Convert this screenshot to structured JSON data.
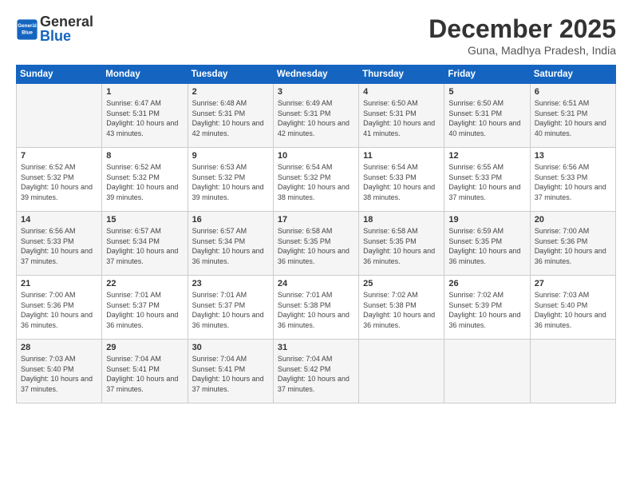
{
  "logo": {
    "line1": "General",
    "line2": "Blue"
  },
  "title": "December 2025",
  "location": "Guna, Madhya Pradesh, India",
  "days_of_week": [
    "Sunday",
    "Monday",
    "Tuesday",
    "Wednesday",
    "Thursday",
    "Friday",
    "Saturday"
  ],
  "weeks": [
    [
      {
        "day": "",
        "sunrise": "",
        "sunset": "",
        "daylight": ""
      },
      {
        "day": "1",
        "sunrise": "Sunrise: 6:47 AM",
        "sunset": "Sunset: 5:31 PM",
        "daylight": "Daylight: 10 hours and 43 minutes."
      },
      {
        "day": "2",
        "sunrise": "Sunrise: 6:48 AM",
        "sunset": "Sunset: 5:31 PM",
        "daylight": "Daylight: 10 hours and 42 minutes."
      },
      {
        "day": "3",
        "sunrise": "Sunrise: 6:49 AM",
        "sunset": "Sunset: 5:31 PM",
        "daylight": "Daylight: 10 hours and 42 minutes."
      },
      {
        "day": "4",
        "sunrise": "Sunrise: 6:50 AM",
        "sunset": "Sunset: 5:31 PM",
        "daylight": "Daylight: 10 hours and 41 minutes."
      },
      {
        "day": "5",
        "sunrise": "Sunrise: 6:50 AM",
        "sunset": "Sunset: 5:31 PM",
        "daylight": "Daylight: 10 hours and 40 minutes."
      },
      {
        "day": "6",
        "sunrise": "Sunrise: 6:51 AM",
        "sunset": "Sunset: 5:31 PM",
        "daylight": "Daylight: 10 hours and 40 minutes."
      }
    ],
    [
      {
        "day": "7",
        "sunrise": "Sunrise: 6:52 AM",
        "sunset": "Sunset: 5:32 PM",
        "daylight": "Daylight: 10 hours and 39 minutes."
      },
      {
        "day": "8",
        "sunrise": "Sunrise: 6:52 AM",
        "sunset": "Sunset: 5:32 PM",
        "daylight": "Daylight: 10 hours and 39 minutes."
      },
      {
        "day": "9",
        "sunrise": "Sunrise: 6:53 AM",
        "sunset": "Sunset: 5:32 PM",
        "daylight": "Daylight: 10 hours and 39 minutes."
      },
      {
        "day": "10",
        "sunrise": "Sunrise: 6:54 AM",
        "sunset": "Sunset: 5:32 PM",
        "daylight": "Daylight: 10 hours and 38 minutes."
      },
      {
        "day": "11",
        "sunrise": "Sunrise: 6:54 AM",
        "sunset": "Sunset: 5:33 PM",
        "daylight": "Daylight: 10 hours and 38 minutes."
      },
      {
        "day": "12",
        "sunrise": "Sunrise: 6:55 AM",
        "sunset": "Sunset: 5:33 PM",
        "daylight": "Daylight: 10 hours and 37 minutes."
      },
      {
        "day": "13",
        "sunrise": "Sunrise: 6:56 AM",
        "sunset": "Sunset: 5:33 PM",
        "daylight": "Daylight: 10 hours and 37 minutes."
      }
    ],
    [
      {
        "day": "14",
        "sunrise": "Sunrise: 6:56 AM",
        "sunset": "Sunset: 5:33 PM",
        "daylight": "Daylight: 10 hours and 37 minutes."
      },
      {
        "day": "15",
        "sunrise": "Sunrise: 6:57 AM",
        "sunset": "Sunset: 5:34 PM",
        "daylight": "Daylight: 10 hours and 37 minutes."
      },
      {
        "day": "16",
        "sunrise": "Sunrise: 6:57 AM",
        "sunset": "Sunset: 5:34 PM",
        "daylight": "Daylight: 10 hours and 36 minutes."
      },
      {
        "day": "17",
        "sunrise": "Sunrise: 6:58 AM",
        "sunset": "Sunset: 5:35 PM",
        "daylight": "Daylight: 10 hours and 36 minutes."
      },
      {
        "day": "18",
        "sunrise": "Sunrise: 6:58 AM",
        "sunset": "Sunset: 5:35 PM",
        "daylight": "Daylight: 10 hours and 36 minutes."
      },
      {
        "day": "19",
        "sunrise": "Sunrise: 6:59 AM",
        "sunset": "Sunset: 5:35 PM",
        "daylight": "Daylight: 10 hours and 36 minutes."
      },
      {
        "day": "20",
        "sunrise": "Sunrise: 7:00 AM",
        "sunset": "Sunset: 5:36 PM",
        "daylight": "Daylight: 10 hours and 36 minutes."
      }
    ],
    [
      {
        "day": "21",
        "sunrise": "Sunrise: 7:00 AM",
        "sunset": "Sunset: 5:36 PM",
        "daylight": "Daylight: 10 hours and 36 minutes."
      },
      {
        "day": "22",
        "sunrise": "Sunrise: 7:01 AM",
        "sunset": "Sunset: 5:37 PM",
        "daylight": "Daylight: 10 hours and 36 minutes."
      },
      {
        "day": "23",
        "sunrise": "Sunrise: 7:01 AM",
        "sunset": "Sunset: 5:37 PM",
        "daylight": "Daylight: 10 hours and 36 minutes."
      },
      {
        "day": "24",
        "sunrise": "Sunrise: 7:01 AM",
        "sunset": "Sunset: 5:38 PM",
        "daylight": "Daylight: 10 hours and 36 minutes."
      },
      {
        "day": "25",
        "sunrise": "Sunrise: 7:02 AM",
        "sunset": "Sunset: 5:38 PM",
        "daylight": "Daylight: 10 hours and 36 minutes."
      },
      {
        "day": "26",
        "sunrise": "Sunrise: 7:02 AM",
        "sunset": "Sunset: 5:39 PM",
        "daylight": "Daylight: 10 hours and 36 minutes."
      },
      {
        "day": "27",
        "sunrise": "Sunrise: 7:03 AM",
        "sunset": "Sunset: 5:40 PM",
        "daylight": "Daylight: 10 hours and 36 minutes."
      }
    ],
    [
      {
        "day": "28",
        "sunrise": "Sunrise: 7:03 AM",
        "sunset": "Sunset: 5:40 PM",
        "daylight": "Daylight: 10 hours and 37 minutes."
      },
      {
        "day": "29",
        "sunrise": "Sunrise: 7:04 AM",
        "sunset": "Sunset: 5:41 PM",
        "daylight": "Daylight: 10 hours and 37 minutes."
      },
      {
        "day": "30",
        "sunrise": "Sunrise: 7:04 AM",
        "sunset": "Sunset: 5:41 PM",
        "daylight": "Daylight: 10 hours and 37 minutes."
      },
      {
        "day": "31",
        "sunrise": "Sunrise: 7:04 AM",
        "sunset": "Sunset: 5:42 PM",
        "daylight": "Daylight: 10 hours and 37 minutes."
      },
      {
        "day": "",
        "sunrise": "",
        "sunset": "",
        "daylight": ""
      },
      {
        "day": "",
        "sunrise": "",
        "sunset": "",
        "daylight": ""
      },
      {
        "day": "",
        "sunrise": "",
        "sunset": "",
        "daylight": ""
      }
    ]
  ]
}
